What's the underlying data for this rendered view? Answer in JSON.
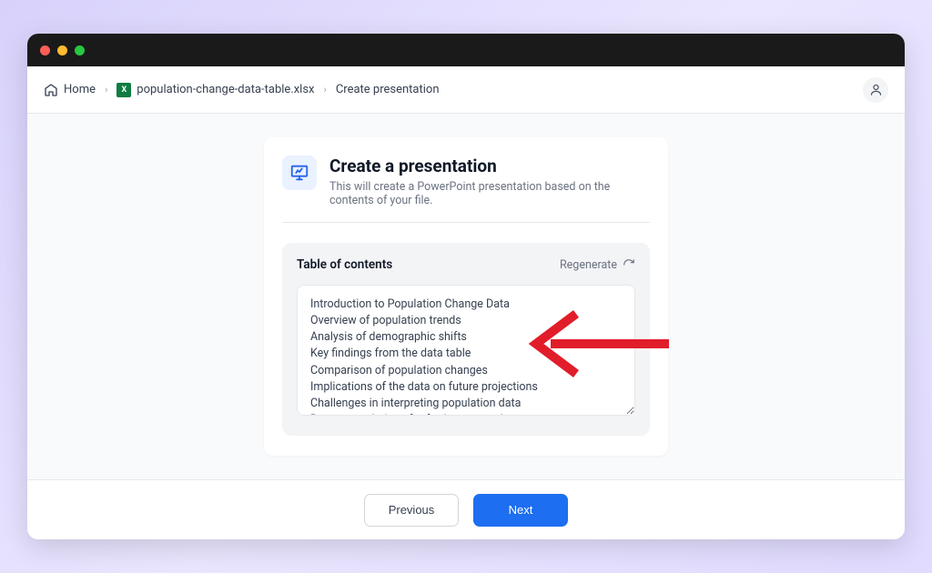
{
  "breadcrumb": {
    "home_label": "Home",
    "file_label": "population-change-data-table.xlsx",
    "page_label": "Create presentation"
  },
  "header": {
    "title": "Create a presentation",
    "subtitle": "This will create a PowerPoint presentation based on the contents of your file."
  },
  "toc": {
    "heading": "Table of contents",
    "regenerate_label": "Regenerate",
    "items": [
      "Introduction to Population Change Data",
      "Overview of population trends",
      "Analysis of demographic shifts",
      "Key findings from the data table",
      "Comparison of population changes",
      "Implications of the data on future projections",
      "Challenges in interpreting population data",
      "Recommendations for further research"
    ]
  },
  "footer": {
    "previous_label": "Previous",
    "next_label": "Next"
  }
}
